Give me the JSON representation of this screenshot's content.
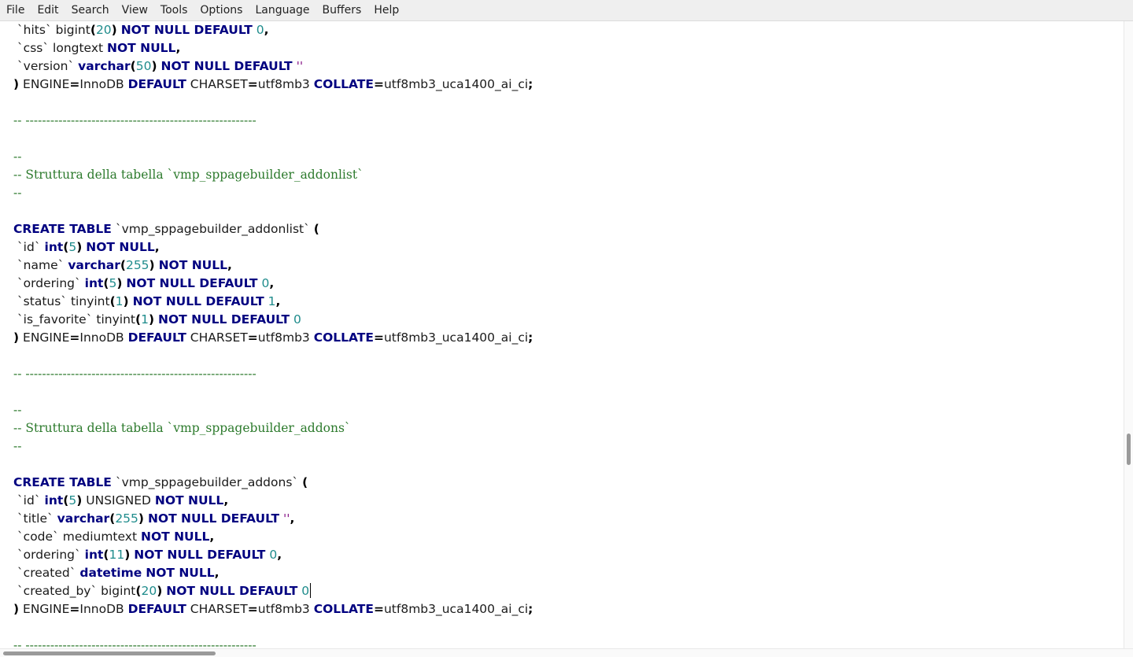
{
  "menu": [
    "File",
    "Edit",
    "Search",
    "View",
    "Tools",
    "Options",
    "Language",
    "Buffers",
    "Help"
  ],
  "colors": {
    "keyword": "#000080",
    "number": "#1f8c8c",
    "string": "#8c1f8c",
    "comment": "#2c7a2c",
    "text": "#1a1a1a"
  },
  "code_lines": [
    [
      [
        "p",
        " `hits` bigint"
      ],
      [
        "o",
        "("
      ],
      [
        "n",
        "20"
      ],
      [
        "o",
        ")"
      ],
      [
        "p",
        " "
      ],
      [
        "k",
        "NOT NULL DEFAULT"
      ],
      [
        "p",
        " "
      ],
      [
        "n",
        "0"
      ],
      [
        "o",
        ","
      ]
    ],
    [
      [
        "p",
        " `css` longtext "
      ],
      [
        "k",
        "NOT NULL"
      ],
      [
        "o",
        ","
      ]
    ],
    [
      [
        "p",
        " `version` "
      ],
      [
        "k",
        "varchar"
      ],
      [
        "o",
        "("
      ],
      [
        "n",
        "50"
      ],
      [
        "o",
        ")"
      ],
      [
        "p",
        " "
      ],
      [
        "k",
        "NOT NULL DEFAULT"
      ],
      [
        "p",
        " "
      ],
      [
        "s",
        "''"
      ]
    ],
    [
      [
        "o",
        ")"
      ],
      [
        "p",
        " ENGINE"
      ],
      [
        "o",
        "="
      ],
      [
        "p",
        "InnoDB "
      ],
      [
        "k",
        "DEFAULT"
      ],
      [
        "p",
        " CHARSET"
      ],
      [
        "o",
        "="
      ],
      [
        "p",
        "utf8mb3 "
      ],
      [
        "k",
        "COLLATE"
      ],
      [
        "o",
        "="
      ],
      [
        "p",
        "utf8mb3_uca1400_ai_ci"
      ],
      [
        "o",
        ";"
      ]
    ],
    [],
    [
      [
        "c",
        "-- --------------------------------------------------------"
      ]
    ],
    [],
    [
      [
        "c",
        "--"
      ]
    ],
    [
      [
        "c",
        "-- Struttura della tabella `vmp_sppagebuilder_addonlist`"
      ]
    ],
    [
      [
        "c",
        "--"
      ]
    ],
    [],
    [
      [
        "k",
        "CREATE TABLE"
      ],
      [
        "p",
        " `vmp_sppagebuilder_addonlist` "
      ],
      [
        "o",
        "("
      ]
    ],
    [
      [
        "p",
        " `id` "
      ],
      [
        "k",
        "int"
      ],
      [
        "o",
        "("
      ],
      [
        "n",
        "5"
      ],
      [
        "o",
        ")"
      ],
      [
        "p",
        " "
      ],
      [
        "k",
        "NOT NULL"
      ],
      [
        "o",
        ","
      ]
    ],
    [
      [
        "p",
        " `name` "
      ],
      [
        "k",
        "varchar"
      ],
      [
        "o",
        "("
      ],
      [
        "n",
        "255"
      ],
      [
        "o",
        ")"
      ],
      [
        "p",
        " "
      ],
      [
        "k",
        "NOT NULL"
      ],
      [
        "o",
        ","
      ]
    ],
    [
      [
        "p",
        " `ordering` "
      ],
      [
        "k",
        "int"
      ],
      [
        "o",
        "("
      ],
      [
        "n",
        "5"
      ],
      [
        "o",
        ")"
      ],
      [
        "p",
        " "
      ],
      [
        "k",
        "NOT NULL DEFAULT"
      ],
      [
        "p",
        " "
      ],
      [
        "n",
        "0"
      ],
      [
        "o",
        ","
      ]
    ],
    [
      [
        "p",
        " `status` tinyint"
      ],
      [
        "o",
        "("
      ],
      [
        "n",
        "1"
      ],
      [
        "o",
        ")"
      ],
      [
        "p",
        " "
      ],
      [
        "k",
        "NOT NULL DEFAULT"
      ],
      [
        "p",
        " "
      ],
      [
        "n",
        "1"
      ],
      [
        "o",
        ","
      ]
    ],
    [
      [
        "p",
        " `is_favorite` tinyint"
      ],
      [
        "o",
        "("
      ],
      [
        "n",
        "1"
      ],
      [
        "o",
        ")"
      ],
      [
        "p",
        " "
      ],
      [
        "k",
        "NOT NULL DEFAULT"
      ],
      [
        "p",
        " "
      ],
      [
        "n",
        "0"
      ]
    ],
    [
      [
        "o",
        ")"
      ],
      [
        "p",
        " ENGINE"
      ],
      [
        "o",
        "="
      ],
      [
        "p",
        "InnoDB "
      ],
      [
        "k",
        "DEFAULT"
      ],
      [
        "p",
        " CHARSET"
      ],
      [
        "o",
        "="
      ],
      [
        "p",
        "utf8mb3 "
      ],
      [
        "k",
        "COLLATE"
      ],
      [
        "o",
        "="
      ],
      [
        "p",
        "utf8mb3_uca1400_ai_ci"
      ],
      [
        "o",
        ";"
      ]
    ],
    [],
    [
      [
        "c",
        "-- --------------------------------------------------------"
      ]
    ],
    [],
    [
      [
        "c",
        "--"
      ]
    ],
    [
      [
        "c",
        "-- Struttura della tabella `vmp_sppagebuilder_addons`"
      ]
    ],
    [
      [
        "c",
        "--"
      ]
    ],
    [],
    [
      [
        "k",
        "CREATE TABLE"
      ],
      [
        "p",
        " `vmp_sppagebuilder_addons` "
      ],
      [
        "o",
        "("
      ]
    ],
    [
      [
        "p",
        " `id` "
      ],
      [
        "k",
        "int"
      ],
      [
        "o",
        "("
      ],
      [
        "n",
        "5"
      ],
      [
        "o",
        ")"
      ],
      [
        "p",
        " UNSIGNED "
      ],
      [
        "k",
        "NOT NULL"
      ],
      [
        "o",
        ","
      ]
    ],
    [
      [
        "p",
        " `title` "
      ],
      [
        "k",
        "varchar"
      ],
      [
        "o",
        "("
      ],
      [
        "n",
        "255"
      ],
      [
        "o",
        ")"
      ],
      [
        "p",
        " "
      ],
      [
        "k",
        "NOT NULL DEFAULT"
      ],
      [
        "p",
        " "
      ],
      [
        "s",
        "''"
      ],
      [
        "o",
        ","
      ]
    ],
    [
      [
        "p",
        " `code` mediumtext "
      ],
      [
        "k",
        "NOT NULL"
      ],
      [
        "o",
        ","
      ]
    ],
    [
      [
        "p",
        " `ordering` "
      ],
      [
        "k",
        "int"
      ],
      [
        "o",
        "("
      ],
      [
        "n",
        "11"
      ],
      [
        "o",
        ")"
      ],
      [
        "p",
        " "
      ],
      [
        "k",
        "NOT NULL DEFAULT"
      ],
      [
        "p",
        " "
      ],
      [
        "n",
        "0"
      ],
      [
        "o",
        ","
      ]
    ],
    [
      [
        "p",
        " `created` "
      ],
      [
        "k",
        "datetime"
      ],
      [
        "p",
        " "
      ],
      [
        "k",
        "NOT NULL"
      ],
      [
        "o",
        ","
      ]
    ],
    [
      [
        "p",
        " `created_by` bigint"
      ],
      [
        "o",
        "("
      ],
      [
        "n",
        "20"
      ],
      [
        "o",
        ")"
      ],
      [
        "p",
        " "
      ],
      [
        "k",
        "NOT NULL DEFAULT"
      ],
      [
        "p",
        " "
      ],
      [
        "n",
        "0"
      ],
      [
        "caret",
        ""
      ]
    ],
    [
      [
        "o",
        ")"
      ],
      [
        "p",
        " ENGINE"
      ],
      [
        "o",
        "="
      ],
      [
        "p",
        "InnoDB "
      ],
      [
        "k",
        "DEFAULT"
      ],
      [
        "p",
        " CHARSET"
      ],
      [
        "o",
        "="
      ],
      [
        "p",
        "utf8mb3 "
      ],
      [
        "k",
        "COLLATE"
      ],
      [
        "o",
        "="
      ],
      [
        "p",
        "utf8mb3_uca1400_ai_ci"
      ],
      [
        "o",
        ";"
      ]
    ],
    [],
    [
      [
        "c",
        "-- --------------------------------------------------------"
      ]
    ]
  ]
}
